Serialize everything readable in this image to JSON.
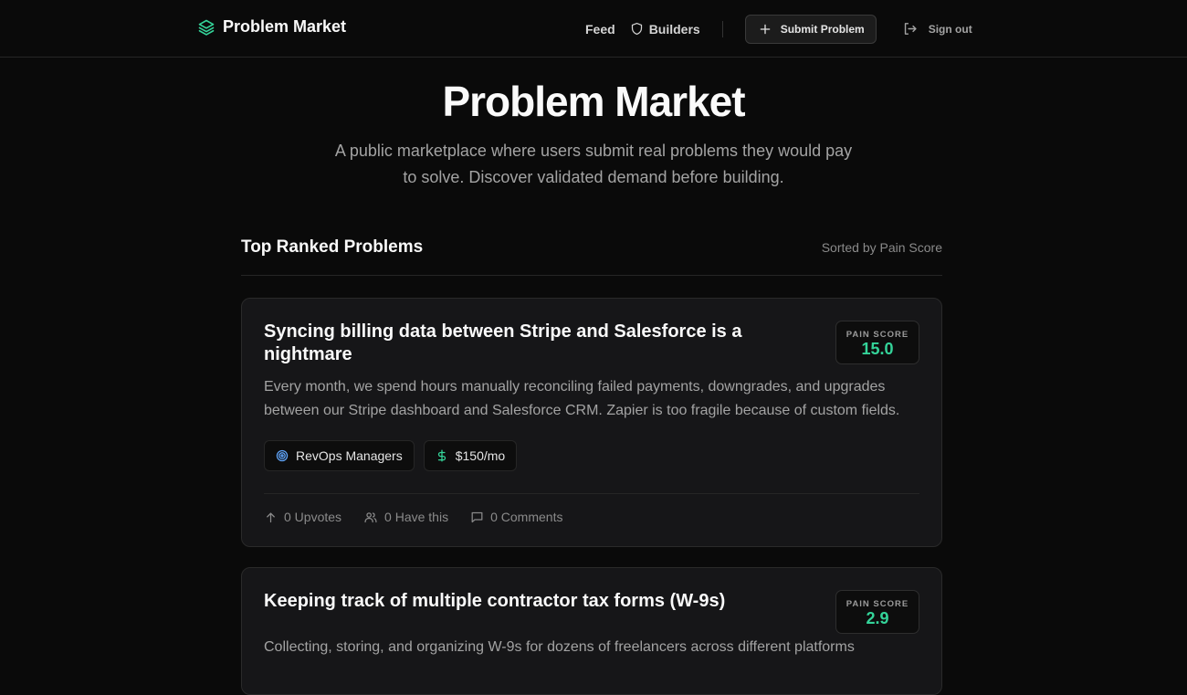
{
  "nav": {
    "brand": "Problem Market",
    "links": {
      "feed": "Feed",
      "builders": "Builders"
    },
    "submit": "Submit Problem",
    "signout": "Sign out"
  },
  "hero": {
    "title": "Problem Market",
    "subtitle": "A public marketplace where users submit real problems they would pay to solve. Discover validated demand before building."
  },
  "list": {
    "title": "Top Ranked Problems",
    "sort": "Sorted by Pain Score"
  },
  "problems": [
    {
      "title": "Syncing billing data between Stripe and Salesforce is a nightmare",
      "score_label": "PAIN SCORE",
      "score": "15.0",
      "description": "Every month, we spend hours manually reconciling failed payments, downgrades, and upgrades between our Stripe dashboard and Salesforce CRM. Zapier is too fragile because of custom fields.",
      "audience": "RevOps Managers",
      "price": "$150/mo",
      "upvotes": "0 Upvotes",
      "have_this": "0 Have this",
      "comments": "0 Comments"
    },
    {
      "title": "Keeping track of multiple contractor tax forms (W-9s)",
      "score_label": "PAIN SCORE",
      "score": "2.9",
      "description": "Collecting, storing, and organizing W-9s for dozens of freelancers across different platforms"
    }
  ],
  "colors": {
    "accent": "#34d399",
    "background": "#0a0a0a",
    "card": "#161618"
  }
}
